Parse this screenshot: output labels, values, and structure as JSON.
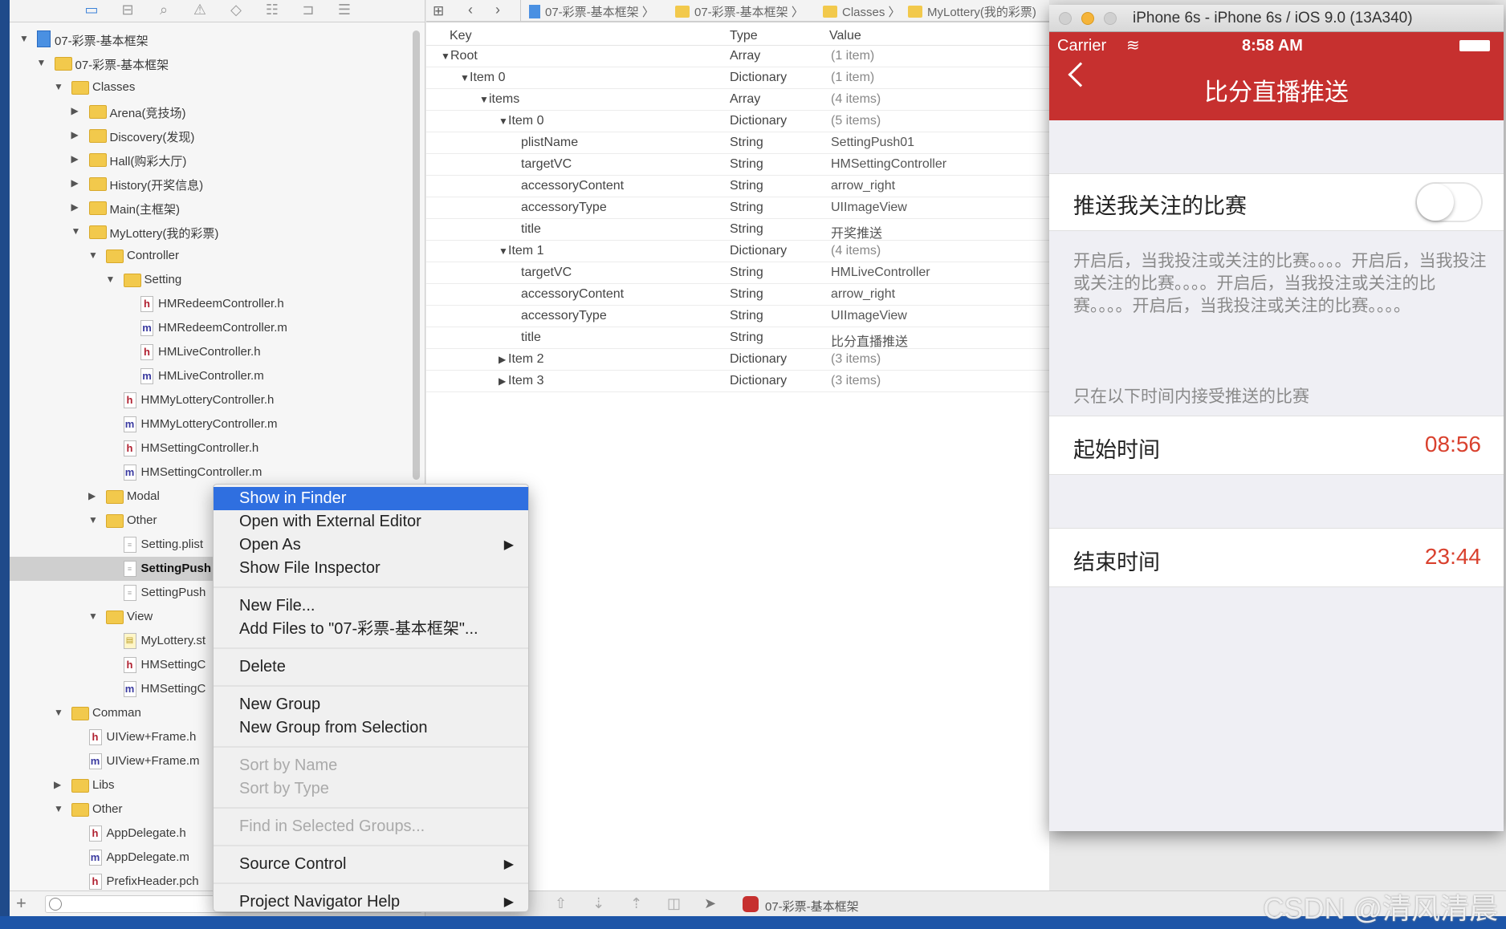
{
  "navigator": {
    "toolbar_icons": [
      "folder-icon",
      "hierarchy-icon",
      "search-icon",
      "warning-icon",
      "test-icon",
      "debug-icon",
      "breakpoint-icon",
      "report-icon"
    ],
    "tree": [
      {
        "label": "07-彩票-基本框架",
        "level": 0,
        "kind": "proj",
        "open": true
      },
      {
        "label": "07-彩票-基本框架",
        "level": 1,
        "kind": "folder",
        "open": true
      },
      {
        "label": "Classes",
        "level": 2,
        "kind": "folder",
        "open": true
      },
      {
        "label": "Arena(竞技场)",
        "level": 3,
        "kind": "folder",
        "open": false
      },
      {
        "label": "Discovery(发现)",
        "level": 3,
        "kind": "folder",
        "open": false
      },
      {
        "label": "Hall(购彩大厅)",
        "level": 3,
        "kind": "folder",
        "open": false
      },
      {
        "label": "History(开奖信息)",
        "level": 3,
        "kind": "folder",
        "open": false
      },
      {
        "label": "Main(主框架)",
        "level": 3,
        "kind": "folder",
        "open": false
      },
      {
        "label": "MyLottery(我的彩票)",
        "level": 3,
        "kind": "folder",
        "open": true
      },
      {
        "label": "Controller",
        "level": 4,
        "kind": "folder",
        "open": true
      },
      {
        "label": "Setting",
        "level": 5,
        "kind": "folder",
        "open": true
      },
      {
        "label": "HMRedeemController.h",
        "level": 6,
        "kind": "h"
      },
      {
        "label": "HMRedeemController.m",
        "level": 6,
        "kind": "m"
      },
      {
        "label": "HMLiveController.h",
        "level": 6,
        "kind": "h"
      },
      {
        "label": "HMLiveController.m",
        "level": 6,
        "kind": "m"
      },
      {
        "label": "HMMyLotteryController.h",
        "level": 5,
        "kind": "h"
      },
      {
        "label": "HMMyLotteryController.m",
        "level": 5,
        "kind": "m"
      },
      {
        "label": "HMSettingController.h",
        "level": 5,
        "kind": "h"
      },
      {
        "label": "HMSettingController.m",
        "level": 5,
        "kind": "m"
      },
      {
        "label": "Modal",
        "level": 4,
        "kind": "folder",
        "open": false
      },
      {
        "label": "Other",
        "level": 4,
        "kind": "folder",
        "open": true
      },
      {
        "label": "Setting.plist",
        "level": 5,
        "kind": "plist"
      },
      {
        "label": "SettingPush",
        "level": 5,
        "kind": "plist",
        "selected": true
      },
      {
        "label": "SettingPush",
        "level": 5,
        "kind": "plist"
      },
      {
        "label": "View",
        "level": 4,
        "kind": "folder",
        "open": true
      },
      {
        "label": "MyLottery.st",
        "level": 5,
        "kind": "sb"
      },
      {
        "label": "HMSettingC",
        "level": 5,
        "kind": "h"
      },
      {
        "label": "HMSettingC",
        "level": 5,
        "kind": "m"
      },
      {
        "label": "Comman",
        "level": 2,
        "kind": "folder",
        "open": true
      },
      {
        "label": "UIView+Frame.h",
        "level": 3,
        "kind": "h"
      },
      {
        "label": "UIView+Frame.m",
        "level": 3,
        "kind": "m"
      },
      {
        "label": "Libs",
        "level": 2,
        "kind": "folder",
        "open": false
      },
      {
        "label": "Other",
        "level": 2,
        "kind": "folder",
        "open": true
      },
      {
        "label": "AppDelegate.h",
        "level": 3,
        "kind": "h"
      },
      {
        "label": "AppDelegate.m",
        "level": 3,
        "kind": "m"
      },
      {
        "label": "PrefixHeader.pch",
        "level": 3,
        "kind": "h"
      }
    ],
    "add_label": "+"
  },
  "jumpbar": {
    "crumbs": [
      "07-彩票-基本框架",
      "07-彩票-基本框架",
      "Classes",
      "MyLottery(我的彩票)"
    ]
  },
  "plist": {
    "headers": {
      "key": "Key",
      "type": "Type",
      "value": "Value"
    },
    "rows": [
      {
        "key": "Root",
        "type": "Array",
        "value": "(1 item)",
        "level": 0,
        "arrow": "open"
      },
      {
        "key": "Item 0",
        "type": "Dictionary",
        "value": "(1 item)",
        "level": 1,
        "arrow": "open"
      },
      {
        "key": "items",
        "type": "Array",
        "value": "(4 items)",
        "level": 2,
        "arrow": "open"
      },
      {
        "key": "Item 0",
        "type": "Dictionary",
        "value": "(5 items)",
        "level": 3,
        "arrow": "open"
      },
      {
        "key": "plistName",
        "type": "String",
        "value": "SettingPush01",
        "level": 4
      },
      {
        "key": "targetVC",
        "type": "String",
        "value": "HMSettingController",
        "level": 4
      },
      {
        "key": "accessoryContent",
        "type": "String",
        "value": "arrow_right",
        "level": 4
      },
      {
        "key": "accessoryType",
        "type": "String",
        "value": "UIImageView",
        "level": 4
      },
      {
        "key": "title",
        "type": "String",
        "value": "开奖推送",
        "level": 4
      },
      {
        "key": "Item 1",
        "type": "Dictionary",
        "value": "(4 items)",
        "level": 3,
        "arrow": "open"
      },
      {
        "key": "targetVC",
        "type": "String",
        "value": "HMLiveController",
        "level": 4
      },
      {
        "key": "accessoryContent",
        "type": "String",
        "value": "arrow_right",
        "level": 4
      },
      {
        "key": "accessoryType",
        "type": "String",
        "value": "UIImageView",
        "level": 4
      },
      {
        "key": "title",
        "type": "String",
        "value": "比分直播推送",
        "level": 4
      },
      {
        "key": "Item 2",
        "type": "Dictionary",
        "value": "(3 items)",
        "level": 3,
        "arrow": "closed"
      },
      {
        "key": "Item 3",
        "type": "Dictionary",
        "value": "(3 items)",
        "level": 3,
        "arrow": "closed"
      }
    ]
  },
  "context_menu": {
    "items": [
      {
        "label": "Show in Finder",
        "highlighted": true
      },
      {
        "label": "Open with External Editor"
      },
      {
        "label": "Open As",
        "submenu": true
      },
      {
        "label": "Show File Inspector"
      },
      {
        "separator": true
      },
      {
        "label": "New File..."
      },
      {
        "label": "Add Files to \"07-彩票-基本框架\"..."
      },
      {
        "separator": true
      },
      {
        "label": "Delete"
      },
      {
        "separator": true
      },
      {
        "label": "New Group"
      },
      {
        "label": "New Group from Selection"
      },
      {
        "separator": true
      },
      {
        "label": "Sort by Name",
        "disabled": true
      },
      {
        "label": "Sort by Type",
        "disabled": true
      },
      {
        "separator": true
      },
      {
        "label": "Find in Selected Groups...",
        "disabled": true
      },
      {
        "separator": true
      },
      {
        "label": "Source Control",
        "submenu": true
      },
      {
        "separator": true
      },
      {
        "label": "Project Navigator Help",
        "submenu": true
      }
    ]
  },
  "editor_bottom": {
    "scheme": "07-彩票-基本框架"
  },
  "simulator": {
    "title": "iPhone 6s - iPhone 6s / iOS 9.0 (13A340)",
    "carrier": "Carrier",
    "time": "8:58 AM",
    "nav_title": "比分直播推送",
    "push_label": "推送我关注的比赛",
    "push_on": false,
    "footer": "开启后，当我投注或关注的比赛。。。。开启后，当我投注或关注的比赛。。。。开启后，当我投注或关注的比赛。。。。开启后，当我投注或关注的比赛。。。。",
    "header": "只在以下时间内接受推送的比赛",
    "start_label": "起始时间",
    "start_time": "08:56",
    "end_label": "结束时间",
    "end_time": "23:44",
    "accent": "#c6302f",
    "time_color": "#d9412e"
  },
  "watermark": "CSDN @清风清晨"
}
